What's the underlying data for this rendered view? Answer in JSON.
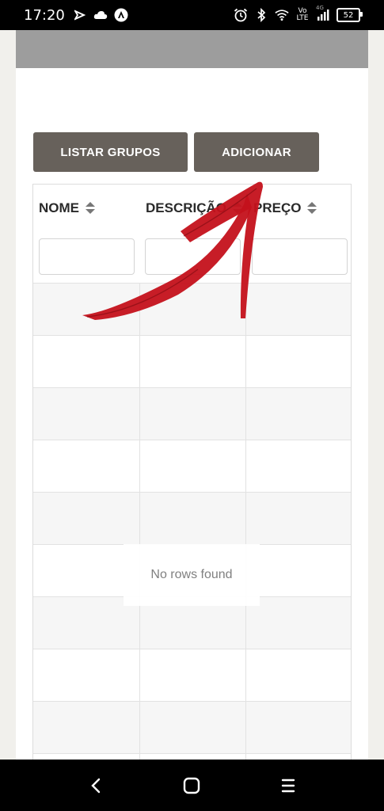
{
  "status_bar": {
    "time": "17:20",
    "left_icons": [
      "navigation-icon",
      "cloud-icon",
      "app-notification-icon"
    ],
    "right_icons": [
      "alarm-icon",
      "bluetooth-icon",
      "wifi-icon",
      "volte-icon",
      "signal-icon"
    ],
    "volte_text": "Vo\nLTE",
    "network_type": "4G",
    "battery": "52"
  },
  "toolbar": {
    "list_groups_label": "LISTAR GRUPOS",
    "add_label": "ADICIONAR"
  },
  "table": {
    "columns": [
      {
        "label": "NOME"
      },
      {
        "label": "DESCRIÇÃO"
      },
      {
        "label": "PREÇO"
      }
    ],
    "empty_message": "No rows found"
  },
  "annotation": {
    "type": "arrow-pointing-to-add-button",
    "color": "#c4111b"
  },
  "nav_bar": {
    "buttons": [
      "back-icon",
      "home-icon",
      "recents-icon"
    ]
  }
}
